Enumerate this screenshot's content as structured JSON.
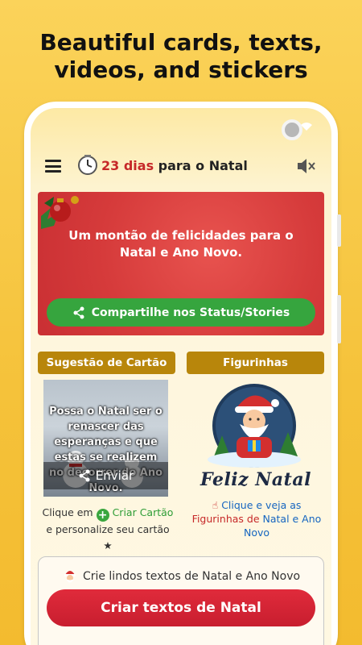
{
  "headline": {
    "line1": "Beautiful cards, texts,",
    "line2": "videos, and stickers"
  },
  "appbar": {
    "icons": [
      "menu-icon",
      "clock-icon",
      "speaker-muted-icon"
    ],
    "days": "23 dias",
    "title_rest": " para o Natal"
  },
  "banner": {
    "text": "Um montão de felicidades para o Natal e Ano Novo.",
    "share_label": "Compartilhe nos Status/Stories"
  },
  "card": {
    "tab_label": "Sugestão de Cartão",
    "message": "Possa o Natal ser o renascer das esperanças e que estas se realizem no decorrer do Ano Novo.",
    "send_label": "Enviar",
    "hint_prefix": "Clique em ",
    "hint_action": "Criar Cartão",
    "hint_suffix": "e personalize seu cartão"
  },
  "stickers": {
    "tab_label": "Figurinhas",
    "sticker_text": "Feliz Natal",
    "hint_line1": "Clique e veja as",
    "hint_link1": "Figurinhas de",
    "hint_link2": "Natal e Ano Novo"
  },
  "bottom": {
    "label": "Crie lindos textos de Natal e Ano Novo",
    "button": "Criar textos de Natal"
  },
  "colors": {
    "accent_red": "#c62828",
    "share_green": "#36a53e",
    "tab_gold": "#b8860b",
    "background_yellow": "#f5c23a"
  }
}
